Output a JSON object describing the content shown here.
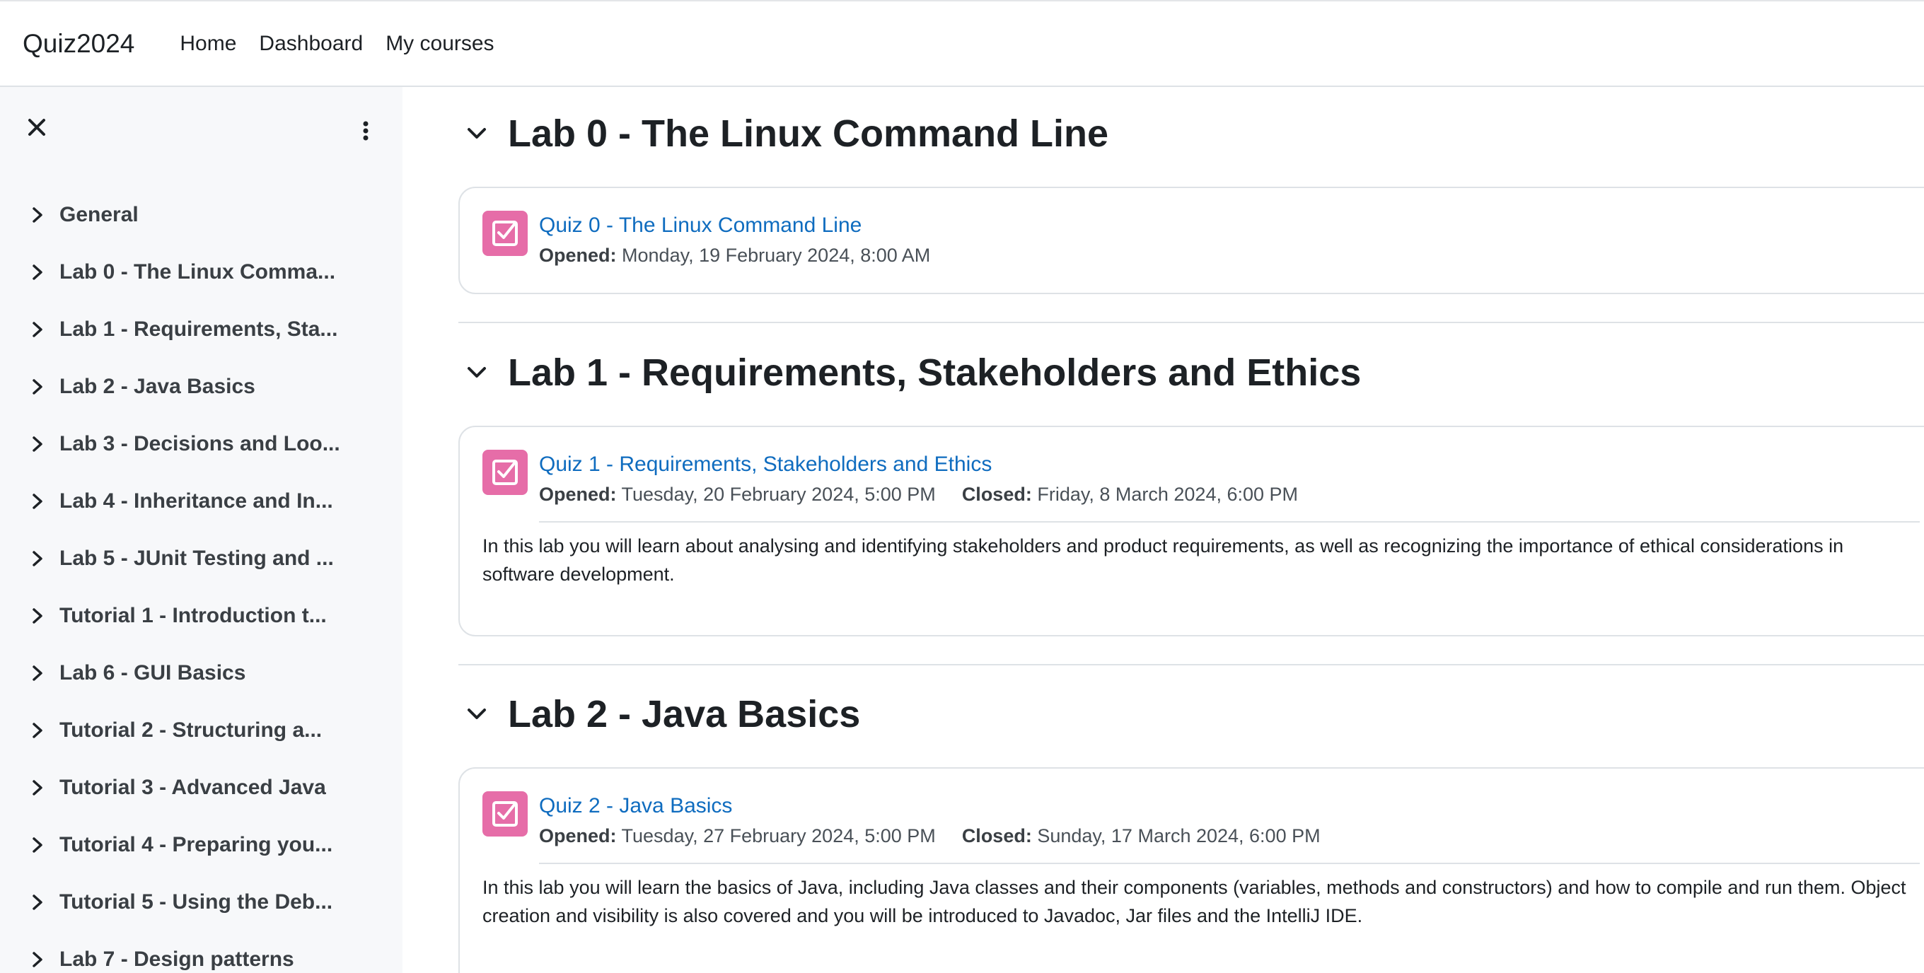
{
  "navbar": {
    "brand": "Quiz2024",
    "links": [
      "Home",
      "Dashboard",
      "My courses"
    ]
  },
  "drawer": {
    "close_icon": "close-icon",
    "menu_icon": "kebab-menu-icon",
    "items": [
      "General",
      "Lab 0 - The Linux Comma...",
      "Lab 1 - Requirements, Sta...",
      "Lab 2 - Java Basics",
      "Lab 3 - Decisions and Loo...",
      "Lab 4 - Inheritance and In...",
      "Lab 5 - JUnit Testing and ...",
      "Tutorial 1 - Introduction t...",
      "Lab 6 - GUI Basics",
      "Tutorial 2 - Structuring a...",
      "Tutorial 3 - Advanced Java",
      "Tutorial 4 - Preparing you...",
      "Tutorial 5 - Using the Deb...",
      "Lab 7 - Design patterns"
    ]
  },
  "sections": [
    {
      "title": "Lab 0 - The Linux Command Line",
      "quiz": {
        "title": "Quiz 0 - The Linux Command Line",
        "opened_label": "Opened:",
        "opened": "Monday, 19 February 2024, 8:00 AM"
      }
    },
    {
      "title": "Lab 1 - Requirements, Stakeholders and Ethics",
      "quiz": {
        "title": "Quiz 1 - Requirements, Stakeholders and Ethics",
        "opened_label": "Opened:",
        "opened": "Tuesday, 20 February 2024, 5:00 PM",
        "closed_label": "Closed:",
        "closed": "Friday, 8 March 2024, 6:00 PM",
        "description": "In this lab you will learn about analysing and identifying stakeholders and product requirements, as well as recognizing the importance of ethical considerations in software development."
      }
    },
    {
      "title": "Lab 2 - Java Basics",
      "quiz": {
        "title": "Quiz 2 - Java Basics",
        "opened_label": "Opened:",
        "opened": "Tuesday, 27 February 2024, 5:00 PM",
        "closed_label": "Closed:",
        "closed": "Sunday, 17 March 2024, 6:00 PM",
        "description": "In this lab you will learn the basics of Java, including Java classes and their components (variables, methods and constructors) and how to compile and run them. Object creation and visibility is also covered and you will be introduced to Javadoc, Jar files and the IntelliJ IDE."
      }
    }
  ],
  "colors": {
    "link": "#0f6cbf",
    "quiz_icon": "#e66da8",
    "drawer_bg": "#f7f8fa"
  }
}
